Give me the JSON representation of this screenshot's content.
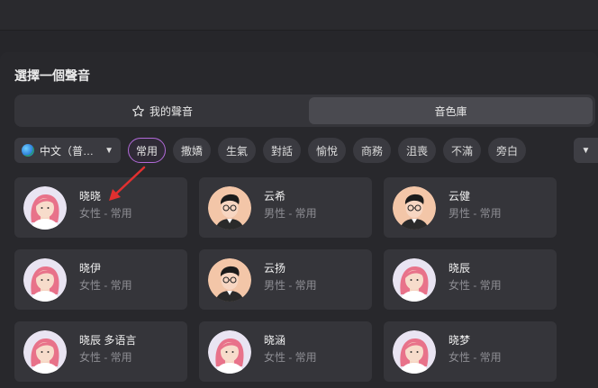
{
  "dialog": {
    "title": "選擇一個聲音",
    "tabs": [
      {
        "label": "我的聲音",
        "icon": "star-icon",
        "selected": false
      },
      {
        "label": "音色庫",
        "selected": true
      }
    ]
  },
  "filters": {
    "language": {
      "label": "中文（普…",
      "icon": "globe-icon"
    },
    "tags": [
      "常用",
      "撒嬌",
      "生氣",
      "對話",
      "愉悅",
      "商務",
      "沮喪",
      "不滿",
      "旁白"
    ],
    "active_tag": "常用"
  },
  "voices": [
    {
      "name": "晓晓",
      "meta": "女性 - 常用",
      "avatar": "female-avatar"
    },
    {
      "name": "云希",
      "meta": "男性 - 常用",
      "avatar": "male-avatar"
    },
    {
      "name": "云健",
      "meta": "男性 - 常用",
      "avatar": "male-avatar"
    },
    {
      "name": "晓伊",
      "meta": "女性 - 常用",
      "avatar": "female-avatar"
    },
    {
      "name": "云扬",
      "meta": "男性 - 常用",
      "avatar": "male-avatar"
    },
    {
      "name": "晓辰",
      "meta": "女性 - 常用",
      "avatar": "female-avatar"
    },
    {
      "name": "晓辰 多语言",
      "meta": "女性 - 常用",
      "avatar": "female-avatar"
    },
    {
      "name": "晓涵",
      "meta": "女性 - 常用",
      "avatar": "female-avatar"
    },
    {
      "name": "晓梦",
      "meta": "女性 - 常用",
      "avatar": "female-avatar"
    }
  ],
  "colors": {
    "accent": "#b16ad8",
    "arrow": "#e03030"
  }
}
